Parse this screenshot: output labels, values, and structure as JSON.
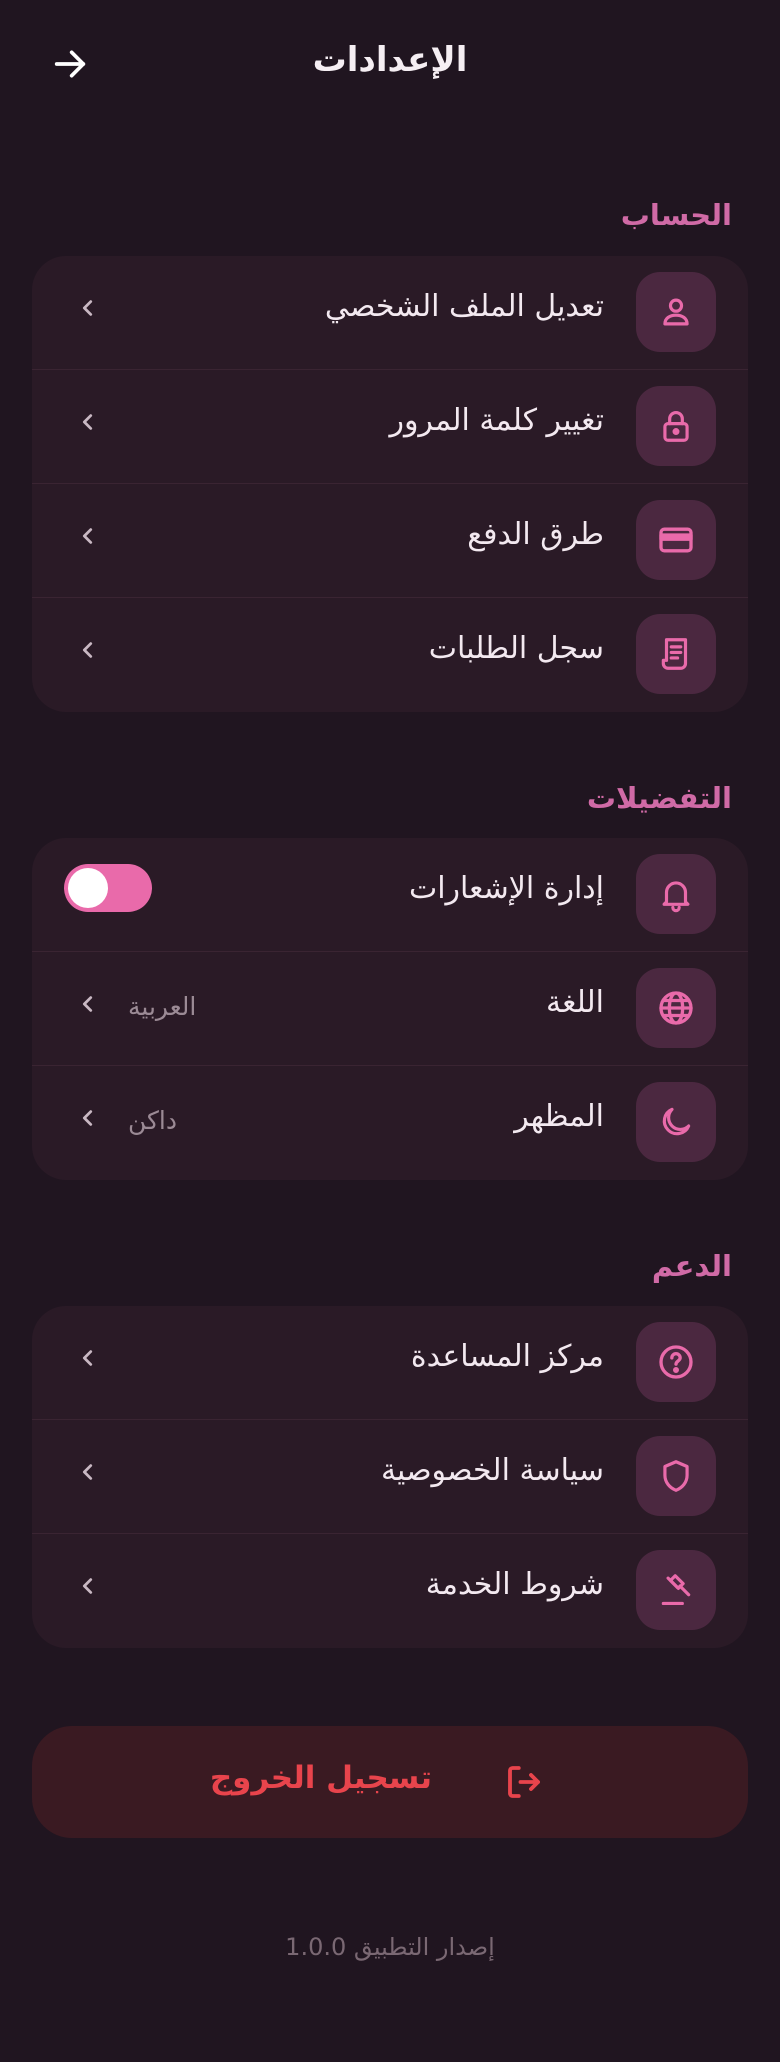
{
  "header": {
    "title": "الإعدادات",
    "back_icon": "arrow-right-icon"
  },
  "colors": {
    "background": "#201520",
    "card": "#2a1a26",
    "accent": "#e96aaa",
    "section_title": "#d06aa6",
    "danger": "#e8444c"
  },
  "sections": {
    "account": {
      "title": "الحساب",
      "items": [
        {
          "label": "تعديل الملف الشخصي",
          "icon": "user-icon"
        },
        {
          "label": "تغيير كلمة المرور",
          "icon": "lock-icon"
        },
        {
          "label": "طرق الدفع",
          "icon": "credit-card-icon"
        },
        {
          "label": "سجل الطلبات",
          "icon": "receipt-icon"
        }
      ]
    },
    "preferences": {
      "title": "التفضيلات",
      "items": [
        {
          "label": "إدارة الإشعارات",
          "icon": "bell-icon",
          "toggle_on": true
        },
        {
          "label": "اللغة",
          "icon": "globe-icon",
          "value": "العربية"
        },
        {
          "label": "المظهر",
          "icon": "moon-icon",
          "value": "داكن"
        }
      ]
    },
    "support": {
      "title": "الدعم",
      "items": [
        {
          "label": "مركز المساعدة",
          "icon": "help-circle-icon"
        },
        {
          "label": "سياسة الخصوصية",
          "icon": "shield-icon"
        },
        {
          "label": "شروط الخدمة",
          "icon": "gavel-icon"
        }
      ]
    }
  },
  "logout": {
    "label": "تسجيل الخروج",
    "icon": "logout-icon"
  },
  "footer": {
    "version": "إصدار التطبيق 1.0.0"
  }
}
